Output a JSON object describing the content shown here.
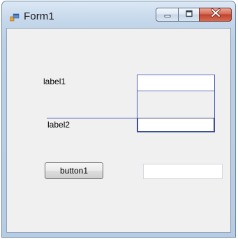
{
  "window": {
    "title": "Form1",
    "app_icon": "windows-form-icon",
    "controls": {
      "minimize_icon": "minimize-icon",
      "maximize_icon": "maximize-icon",
      "close_icon": "close-icon"
    }
  },
  "form": {
    "label1": "label1",
    "label2": "label2",
    "button1": "button1",
    "textbox1_value": "",
    "textbox2_value": "",
    "textbox3_value": ""
  },
  "colors": {
    "selection_outline": "#4a5fb8",
    "close_button": "#c7432d"
  }
}
